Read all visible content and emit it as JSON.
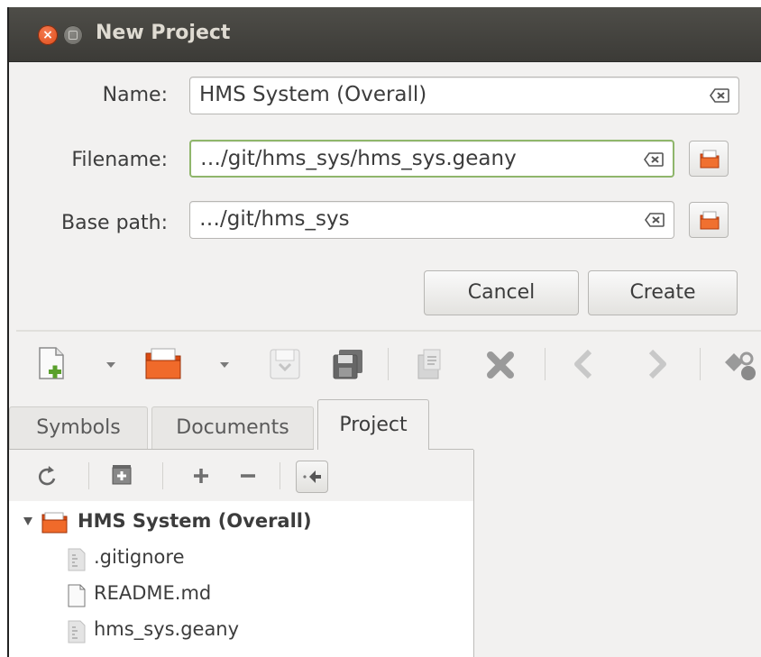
{
  "dialog": {
    "title": "New Project",
    "fields": {
      "name": {
        "label": "Name:",
        "value": "HMS System (Overall)"
      },
      "filename": {
        "label": "Filename:",
        "value": "…/git/hms_sys/hms_sys.geany"
      },
      "base_path": {
        "label": "Base path:",
        "value": "…/git/hms_sys"
      }
    },
    "buttons": {
      "cancel": "Cancel",
      "create": "Create"
    }
  },
  "toolbar": {
    "icons": [
      "new-file-icon",
      "open-folder-icon",
      "save-icon",
      "save-all-icon",
      "reload-icon",
      "close-icon",
      "back-icon",
      "forward-icon",
      "compile-icon"
    ]
  },
  "sidebar": {
    "tabs": [
      "Symbols",
      "Documents",
      "Project"
    ],
    "active_tab": "Project",
    "tree": {
      "root": "HMS System (Overall)",
      "items": [
        ".gitignore",
        "README.md",
        "hms_sys.geany"
      ]
    }
  },
  "colors": {
    "titlebar": "#3c3b37",
    "focus_border": "#8fb66b",
    "folder": "#e8561c",
    "close_button": "#df4a16"
  }
}
